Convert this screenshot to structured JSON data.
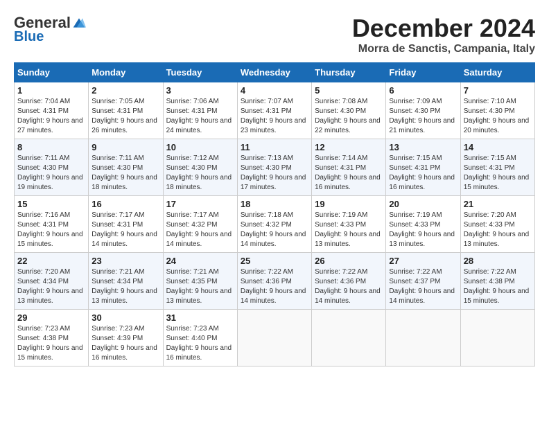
{
  "header": {
    "logo_general": "General",
    "logo_blue": "Blue",
    "month_title": "December 2024",
    "location": "Morra de Sanctis, Campania, Italy"
  },
  "days_of_week": [
    "Sunday",
    "Monday",
    "Tuesday",
    "Wednesday",
    "Thursday",
    "Friday",
    "Saturday"
  ],
  "weeks": [
    [
      {
        "day": "1",
        "info": "Sunrise: 7:04 AM\nSunset: 4:31 PM\nDaylight: 9 hours and 27 minutes."
      },
      {
        "day": "2",
        "info": "Sunrise: 7:05 AM\nSunset: 4:31 PM\nDaylight: 9 hours and 26 minutes."
      },
      {
        "day": "3",
        "info": "Sunrise: 7:06 AM\nSunset: 4:31 PM\nDaylight: 9 hours and 24 minutes."
      },
      {
        "day": "4",
        "info": "Sunrise: 7:07 AM\nSunset: 4:31 PM\nDaylight: 9 hours and 23 minutes."
      },
      {
        "day": "5",
        "info": "Sunrise: 7:08 AM\nSunset: 4:30 PM\nDaylight: 9 hours and 22 minutes."
      },
      {
        "day": "6",
        "info": "Sunrise: 7:09 AM\nSunset: 4:30 PM\nDaylight: 9 hours and 21 minutes."
      },
      {
        "day": "7",
        "info": "Sunrise: 7:10 AM\nSunset: 4:30 PM\nDaylight: 9 hours and 20 minutes."
      }
    ],
    [
      {
        "day": "8",
        "info": "Sunrise: 7:11 AM\nSunset: 4:30 PM\nDaylight: 9 hours and 19 minutes."
      },
      {
        "day": "9",
        "info": "Sunrise: 7:11 AM\nSunset: 4:30 PM\nDaylight: 9 hours and 18 minutes."
      },
      {
        "day": "10",
        "info": "Sunrise: 7:12 AM\nSunset: 4:30 PM\nDaylight: 9 hours and 18 minutes."
      },
      {
        "day": "11",
        "info": "Sunrise: 7:13 AM\nSunset: 4:30 PM\nDaylight: 9 hours and 17 minutes."
      },
      {
        "day": "12",
        "info": "Sunrise: 7:14 AM\nSunset: 4:31 PM\nDaylight: 9 hours and 16 minutes."
      },
      {
        "day": "13",
        "info": "Sunrise: 7:15 AM\nSunset: 4:31 PM\nDaylight: 9 hours and 16 minutes."
      },
      {
        "day": "14",
        "info": "Sunrise: 7:15 AM\nSunset: 4:31 PM\nDaylight: 9 hours and 15 minutes."
      }
    ],
    [
      {
        "day": "15",
        "info": "Sunrise: 7:16 AM\nSunset: 4:31 PM\nDaylight: 9 hours and 15 minutes."
      },
      {
        "day": "16",
        "info": "Sunrise: 7:17 AM\nSunset: 4:31 PM\nDaylight: 9 hours and 14 minutes."
      },
      {
        "day": "17",
        "info": "Sunrise: 7:17 AM\nSunset: 4:32 PM\nDaylight: 9 hours and 14 minutes."
      },
      {
        "day": "18",
        "info": "Sunrise: 7:18 AM\nSunset: 4:32 PM\nDaylight: 9 hours and 14 minutes."
      },
      {
        "day": "19",
        "info": "Sunrise: 7:19 AM\nSunset: 4:33 PM\nDaylight: 9 hours and 13 minutes."
      },
      {
        "day": "20",
        "info": "Sunrise: 7:19 AM\nSunset: 4:33 PM\nDaylight: 9 hours and 13 minutes."
      },
      {
        "day": "21",
        "info": "Sunrise: 7:20 AM\nSunset: 4:33 PM\nDaylight: 9 hours and 13 minutes."
      }
    ],
    [
      {
        "day": "22",
        "info": "Sunrise: 7:20 AM\nSunset: 4:34 PM\nDaylight: 9 hours and 13 minutes."
      },
      {
        "day": "23",
        "info": "Sunrise: 7:21 AM\nSunset: 4:34 PM\nDaylight: 9 hours and 13 minutes."
      },
      {
        "day": "24",
        "info": "Sunrise: 7:21 AM\nSunset: 4:35 PM\nDaylight: 9 hours and 13 minutes."
      },
      {
        "day": "25",
        "info": "Sunrise: 7:22 AM\nSunset: 4:36 PM\nDaylight: 9 hours and 14 minutes."
      },
      {
        "day": "26",
        "info": "Sunrise: 7:22 AM\nSunset: 4:36 PM\nDaylight: 9 hours and 14 minutes."
      },
      {
        "day": "27",
        "info": "Sunrise: 7:22 AM\nSunset: 4:37 PM\nDaylight: 9 hours and 14 minutes."
      },
      {
        "day": "28",
        "info": "Sunrise: 7:22 AM\nSunset: 4:38 PM\nDaylight: 9 hours and 15 minutes."
      }
    ],
    [
      {
        "day": "29",
        "info": "Sunrise: 7:23 AM\nSunset: 4:38 PM\nDaylight: 9 hours and 15 minutes."
      },
      {
        "day": "30",
        "info": "Sunrise: 7:23 AM\nSunset: 4:39 PM\nDaylight: 9 hours and 16 minutes."
      },
      {
        "day": "31",
        "info": "Sunrise: 7:23 AM\nSunset: 4:40 PM\nDaylight: 9 hours and 16 minutes."
      },
      null,
      null,
      null,
      null
    ]
  ]
}
